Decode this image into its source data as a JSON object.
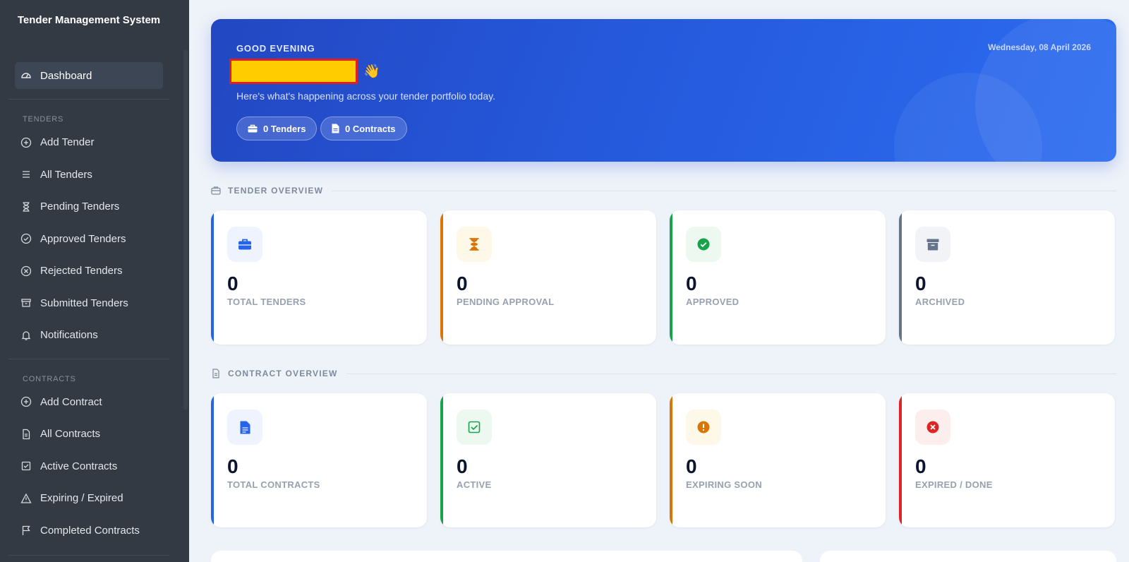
{
  "sidebar": {
    "brand": "Tender Management System",
    "dashboard_label": "Dashboard",
    "tenders_section": "TENDERS",
    "tender_items": [
      {
        "label": "Add Tender",
        "icon": "plus-circle-icon"
      },
      {
        "label": "All Tenders",
        "icon": "list-icon"
      },
      {
        "label": "Pending Tenders",
        "icon": "hourglass-icon"
      },
      {
        "label": "Approved Tenders",
        "icon": "check-circle-icon"
      },
      {
        "label": "Rejected Tenders",
        "icon": "x-circle-icon"
      },
      {
        "label": "Submitted Tenders",
        "icon": "archive-icon"
      },
      {
        "label": "Notifications",
        "icon": "bell-icon"
      }
    ],
    "contracts_section": "CONTRACTS",
    "contract_items": [
      {
        "label": "Add Contract",
        "icon": "plus-circle-icon"
      },
      {
        "label": "All Contracts",
        "icon": "document-icon"
      },
      {
        "label": "Active Contracts",
        "icon": "check-square-icon"
      },
      {
        "label": "Expiring / Expired",
        "icon": "warning-icon"
      },
      {
        "label": "Completed Contracts",
        "icon": "flag-icon"
      }
    ]
  },
  "hero": {
    "greeting": "GOOD EVENING",
    "subtitle": "Here's what's happening across your tender portfolio today.",
    "date": "Wednesday, 08 April 2026",
    "tenders_pill": "0 Tenders",
    "contracts_pill": "0 Contracts",
    "wave_emoji": "👋"
  },
  "tender_overview": {
    "title": "TENDER OVERVIEW",
    "cards": [
      {
        "value": "0",
        "label": "TOTAL TENDERS",
        "accent": "#2563eb",
        "icon": "briefcase-icon"
      },
      {
        "value": "0",
        "label": "PENDING APPROVAL",
        "accent": "#d97706",
        "icon": "hourglass-icon"
      },
      {
        "value": "0",
        "label": "APPROVED",
        "accent": "#16a34a",
        "icon": "check-circle-icon"
      },
      {
        "value": "0",
        "label": "ARCHIVED",
        "accent": "#64748b",
        "icon": "archive-icon"
      }
    ]
  },
  "contract_overview": {
    "title": "CONTRACT OVERVIEW",
    "cards": [
      {
        "value": "0",
        "label": "TOTAL CONTRACTS",
        "accent": "#2563eb",
        "icon": "document-icon"
      },
      {
        "value": "0",
        "label": "ACTIVE",
        "accent": "#16a34a",
        "icon": "check-square-icon"
      },
      {
        "value": "0",
        "label": "EXPIRING SOON",
        "accent": "#d97706",
        "icon": "exclamation-circle-icon"
      },
      {
        "value": "0",
        "label": "EXPIRED / DONE",
        "accent": "#dc2626",
        "icon": "x-circle-icon"
      }
    ]
  }
}
